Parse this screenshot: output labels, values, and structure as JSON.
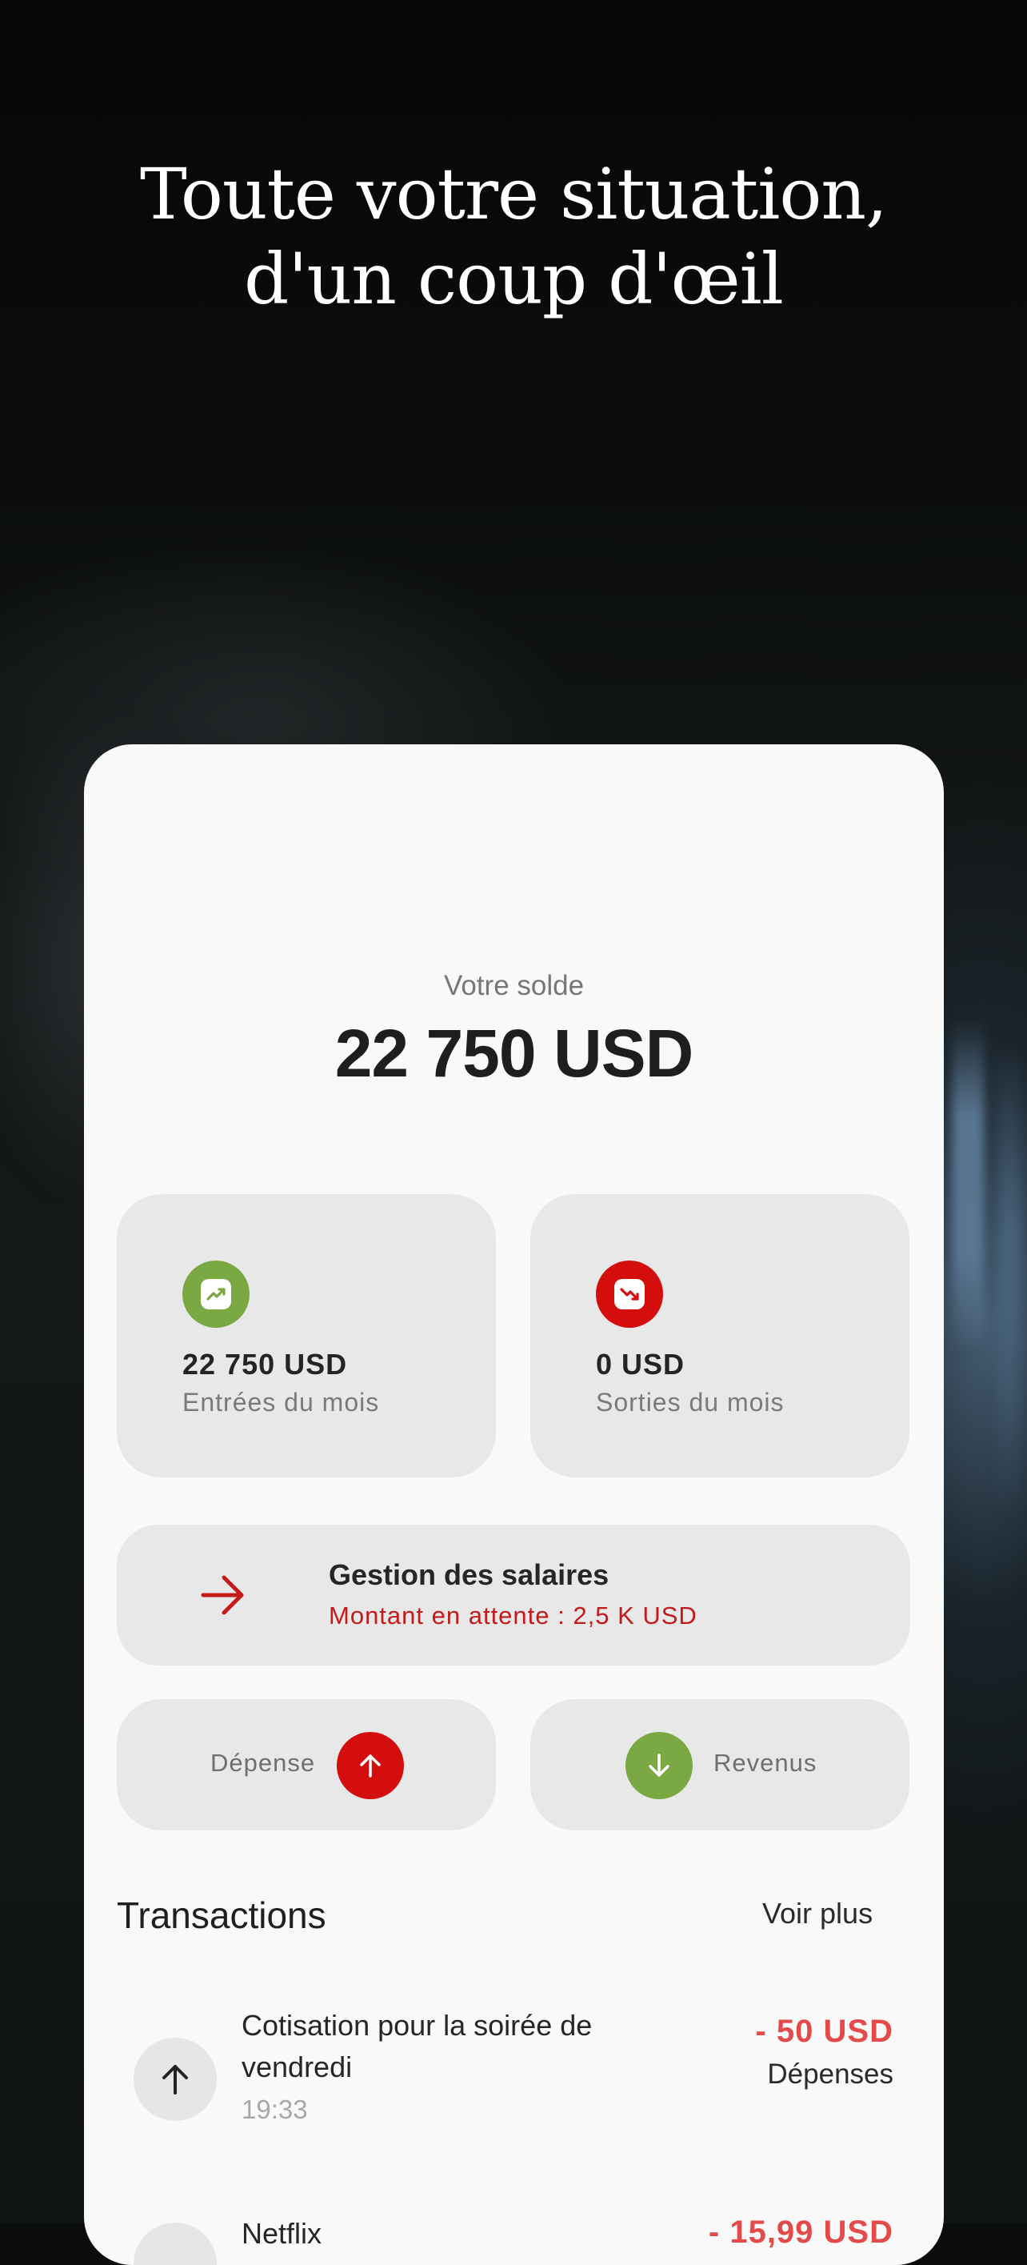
{
  "headline": {
    "line1": "Toute votre situation,",
    "line2": "d'un coup d'œil"
  },
  "balance": {
    "label": "Votre solde",
    "value": "22 750 USD"
  },
  "stats": {
    "income": {
      "amount": "22 750 USD",
      "label": "Entrées du mois",
      "icon": "trend-up-icon",
      "color": "#7aa843"
    },
    "expense": {
      "amount": "0 USD",
      "label": "Sorties du mois",
      "icon": "trend-down-icon",
      "color": "#d40d0d"
    }
  },
  "salary": {
    "title": "Gestion des salaires",
    "subtitle": "Montant en attente : 2,5 K USD",
    "icon": "arrow-right-icon"
  },
  "actions": {
    "expense": {
      "label": "Dépense",
      "icon": "arrow-up-icon",
      "color": "#d40d0d"
    },
    "income": {
      "label": "Revenus",
      "icon": "arrow-down-icon",
      "color": "#7aa843"
    }
  },
  "transactions": {
    "title": "Transactions",
    "more": "Voir plus",
    "items": [
      {
        "title": "Cotisation pour la soirée de vendredi",
        "time": "19:33",
        "amount": "- 50 USD",
        "category": "Dépenses",
        "icon": "arrow-up-icon"
      },
      {
        "title": "Netflix",
        "time": "",
        "amount": "- 15,99 USD",
        "category": "",
        "icon": "arrow-up-icon"
      }
    ]
  }
}
